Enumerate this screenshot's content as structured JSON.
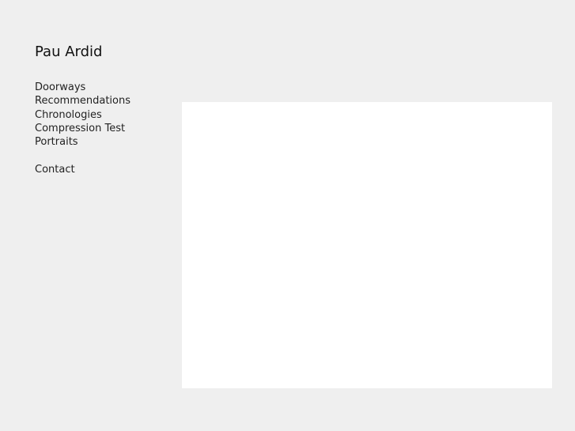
{
  "site": {
    "title": "Pau Ardid"
  },
  "nav": {
    "items": [
      {
        "label": "Doorways"
      },
      {
        "label": "Recommendations"
      },
      {
        "label": "Chronologies"
      },
      {
        "label": "Compression Test"
      },
      {
        "label": "Portraits"
      }
    ],
    "contact": {
      "label": "Contact"
    }
  },
  "colors": {
    "background": "#efefef",
    "panel": "#ffffff",
    "text": "#222222"
  }
}
